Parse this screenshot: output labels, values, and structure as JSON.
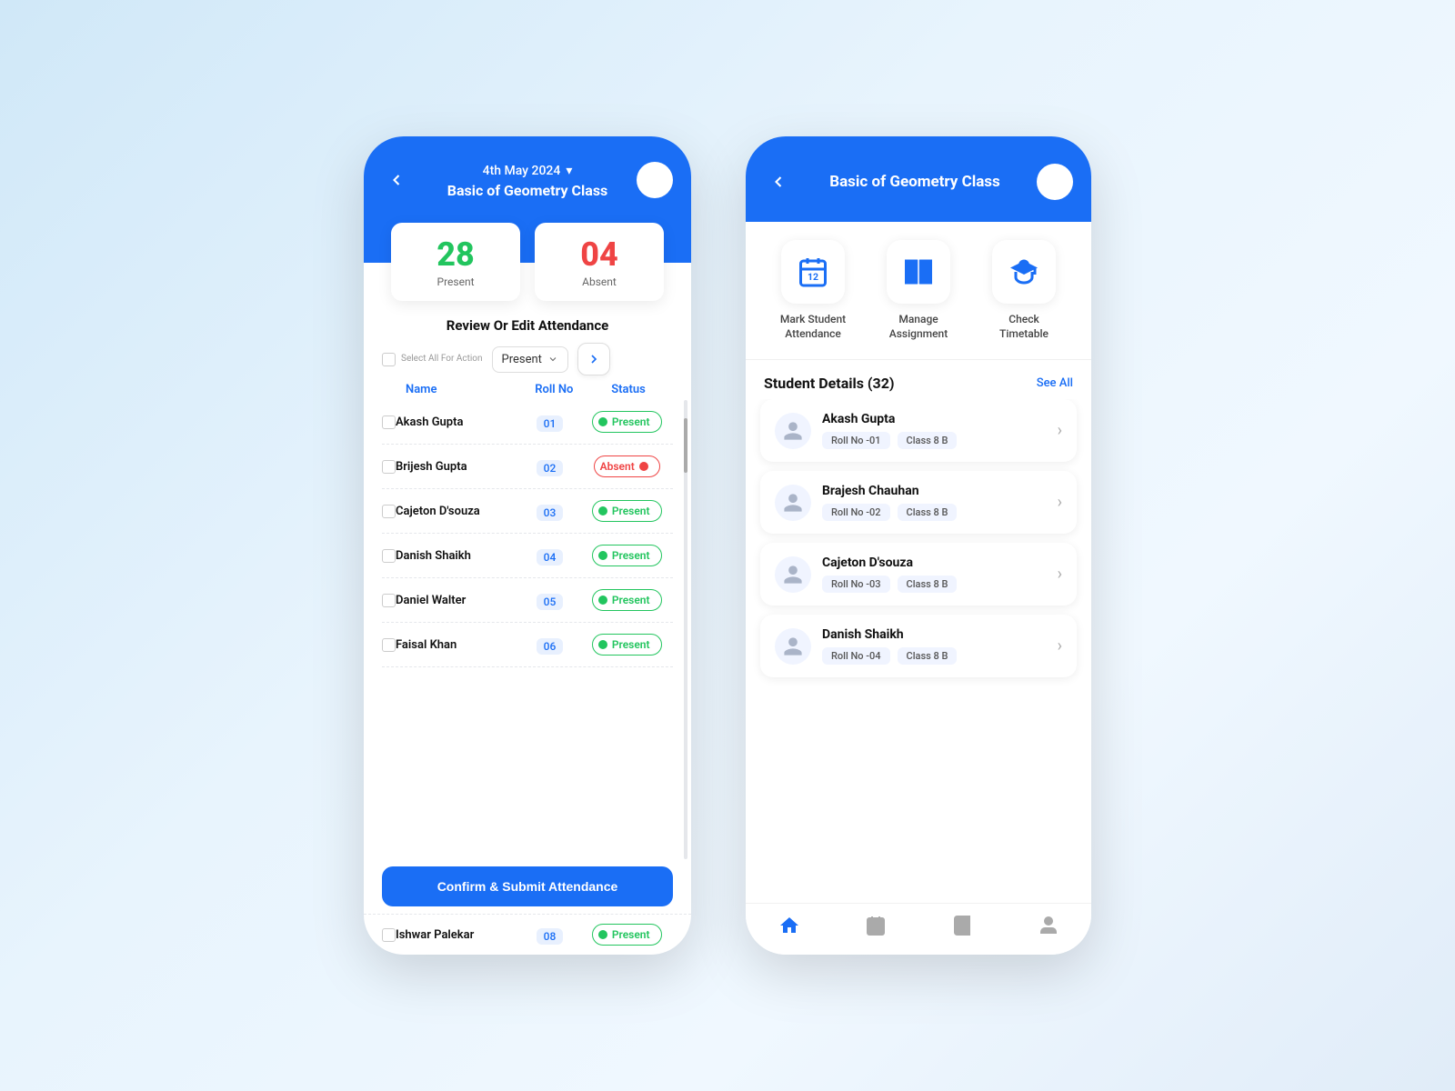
{
  "left_phone": {
    "header": {
      "date": "4th May 2024",
      "class_title": "Basic of Geometry Class",
      "back_icon": "‹",
      "dropdown_icon": "▾"
    },
    "stats": {
      "present": {
        "number": "28",
        "label": "Present"
      },
      "absent": {
        "number": "04",
        "label": "Absent"
      }
    },
    "section_title": "Review Or Edit Attendance",
    "action_bar": {
      "select_all_label": "Select All For Action",
      "dropdown_value": "Present",
      "go_icon": "›"
    },
    "table_headers": {
      "name": "Name",
      "roll_no": "Roll No",
      "status": "Status"
    },
    "students": [
      {
        "name": "Akash Gupta",
        "roll": "01",
        "status": "Present"
      },
      {
        "name": "Brijesh Gupta",
        "roll": "02",
        "status": "Absent"
      },
      {
        "name": "Cajeton D'souza",
        "roll": "03",
        "status": "Present"
      },
      {
        "name": "Danish Shaikh",
        "roll": "04",
        "status": "Present"
      },
      {
        "name": "Daniel Walter",
        "roll": "05",
        "status": "Present"
      },
      {
        "name": "Faisal Khan",
        "roll": "06",
        "status": "Present"
      },
      {
        "name": "Ishwar Palekar",
        "roll": "08",
        "status": "Present"
      }
    ],
    "submit_btn": "Confirm & Submit Attendance"
  },
  "right_phone": {
    "header": {
      "back_icon": "‹",
      "class_title": "Basic of Geometry Class"
    },
    "quick_actions": [
      {
        "id": "mark_attendance",
        "label": "Mark Student\nAttendance"
      },
      {
        "id": "manage_assignment",
        "label": "Manage\nAssignment"
      },
      {
        "id": "check_timetable",
        "label": "Check\nTimetable"
      }
    ],
    "student_details": {
      "title": "Student Details (32)",
      "see_all": "See All",
      "students": [
        {
          "name": "Akash Gupta",
          "roll": "Roll No -01",
          "class": "Class 8 B"
        },
        {
          "name": "Brajesh Chauhan",
          "roll": "Roll No -02",
          "class": "Class 8 B"
        },
        {
          "name": "Cajeton D'souza",
          "roll": "Roll No -03",
          "class": "Class 8 B"
        },
        {
          "name": "Danish Shaikh",
          "roll": "Roll No -04",
          "class": "Class 8 B"
        }
      ]
    },
    "bottom_nav": [
      {
        "id": "home",
        "active": true
      },
      {
        "id": "calendar",
        "active": false
      },
      {
        "id": "book",
        "active": false
      },
      {
        "id": "profile",
        "active": false
      }
    ]
  }
}
